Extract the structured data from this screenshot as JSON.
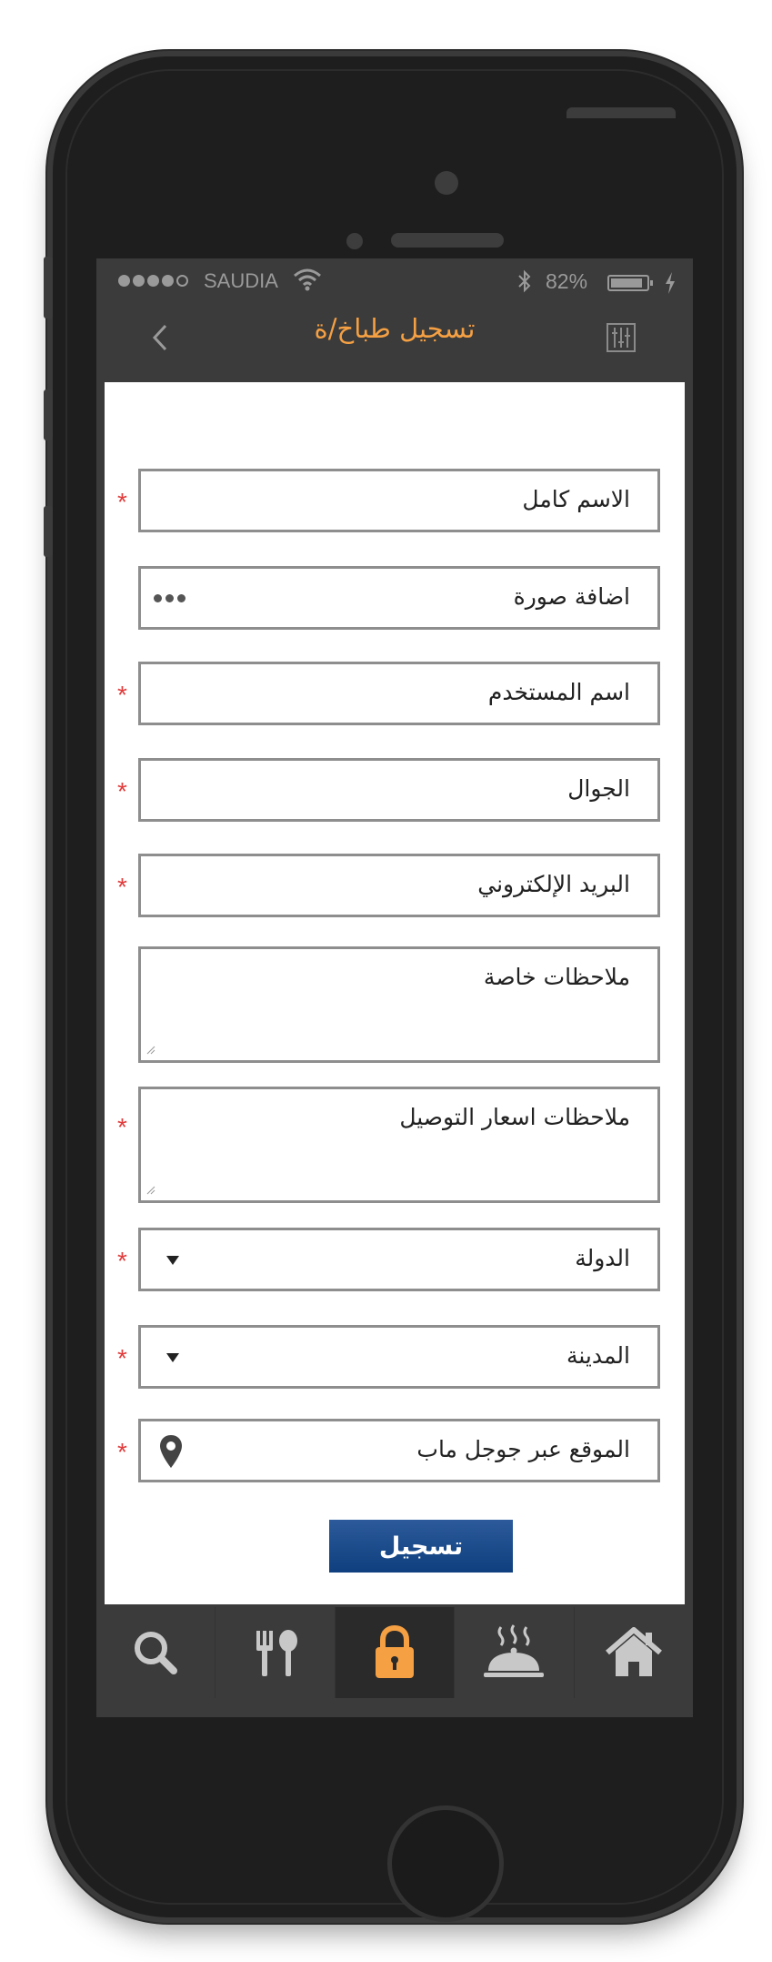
{
  "statusbar": {
    "carrier": "SAUDIA",
    "battery": "82%",
    "battery_level": 0.82,
    "signal_bars": 4,
    "icons": [
      "signal-dots-icon",
      "wifi-icon",
      "bluetooth-icon",
      "battery-icon",
      "charging-icon"
    ]
  },
  "navbar": {
    "title": "تسجيل طباخ/ة",
    "back_icon": "chevron-left-icon",
    "settings_icon": "sliders-icon"
  },
  "form": {
    "fields": [
      {
        "label": "الاسم كامل",
        "required": true,
        "type": "text"
      },
      {
        "label": "اضافة صورة",
        "required": false,
        "type": "image-picker"
      },
      {
        "label": "اسم المستخدم",
        "required": true,
        "type": "text"
      },
      {
        "label": "الجوال",
        "required": true,
        "type": "text"
      },
      {
        "label": "البريد الإلكتروني",
        "required": true,
        "type": "text"
      },
      {
        "label": "ملاحظات خاصة",
        "required": false,
        "type": "textarea"
      },
      {
        "label": "ملاحظات اسعار التوصيل",
        "required": true,
        "type": "textarea"
      },
      {
        "label": "الدولة",
        "required": true,
        "type": "select"
      },
      {
        "label": "المدينة",
        "required": true,
        "type": "select"
      },
      {
        "label": "الموقع عبر جوجل ماب",
        "required": true,
        "type": "map-location"
      }
    ],
    "required_mark": "*",
    "submit_label": "تسجيل"
  },
  "tabbar": {
    "tabs": [
      {
        "icon": "search-icon",
        "active": false
      },
      {
        "icon": "fork-spoon-icon",
        "active": false
      },
      {
        "icon": "lock-icon",
        "active": true
      },
      {
        "icon": "serving-dish-icon",
        "active": false
      },
      {
        "icon": "home-icon",
        "active": false
      }
    ]
  },
  "colors": {
    "accent": "#f5a043",
    "required": "#e23b3b",
    "button": "#1f4d8c",
    "bar_background": "#3b3b3b"
  }
}
